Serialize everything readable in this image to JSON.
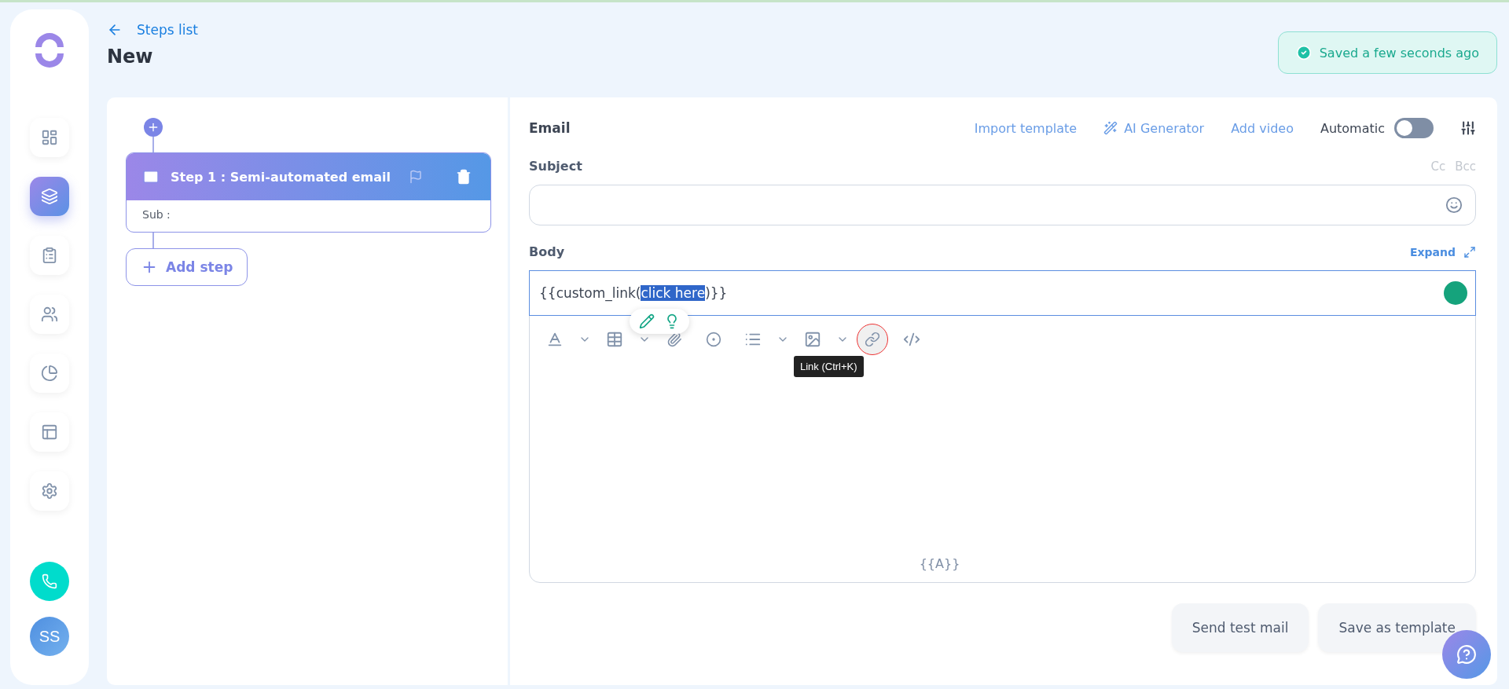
{
  "sidebar": {
    "items": [
      {
        "selected": false
      },
      {
        "selected": true
      },
      {
        "selected": false
      },
      {
        "selected": false
      },
      {
        "selected": false
      },
      {
        "selected": false
      },
      {
        "selected": false
      }
    ],
    "avatar": "SS"
  },
  "header": {
    "back_link": "Steps list",
    "title": "New",
    "status": "Saved a few seconds ago"
  },
  "steps": [
    {
      "title": "Step 1 : Semi-automated email",
      "subtitle": "Sub :"
    }
  ],
  "add_step": "Add step",
  "email": {
    "heading": "Email",
    "actions": [
      "Import template",
      "AI Generator",
      "Add video"
    ],
    "automatic": {
      "label": "Automatic",
      "on": false
    },
    "subject": {
      "label": "Subject",
      "cc": "Cc",
      "bcc": "Bcc"
    },
    "body": {
      "label": "Body",
      "expand": "Expand",
      "parts": [
        {
          "text": "{{custom_link(",
          "selected": false
        },
        {
          "text": "click here",
          "selected": true
        },
        {
          "text": ")}}",
          "selected": false
        }
      ],
      "tooltip": "Link (Ctrl+K)",
      "footer": "{{A}}"
    }
  },
  "buttons": [
    "Send test mail",
    "Save as template"
  ]
}
